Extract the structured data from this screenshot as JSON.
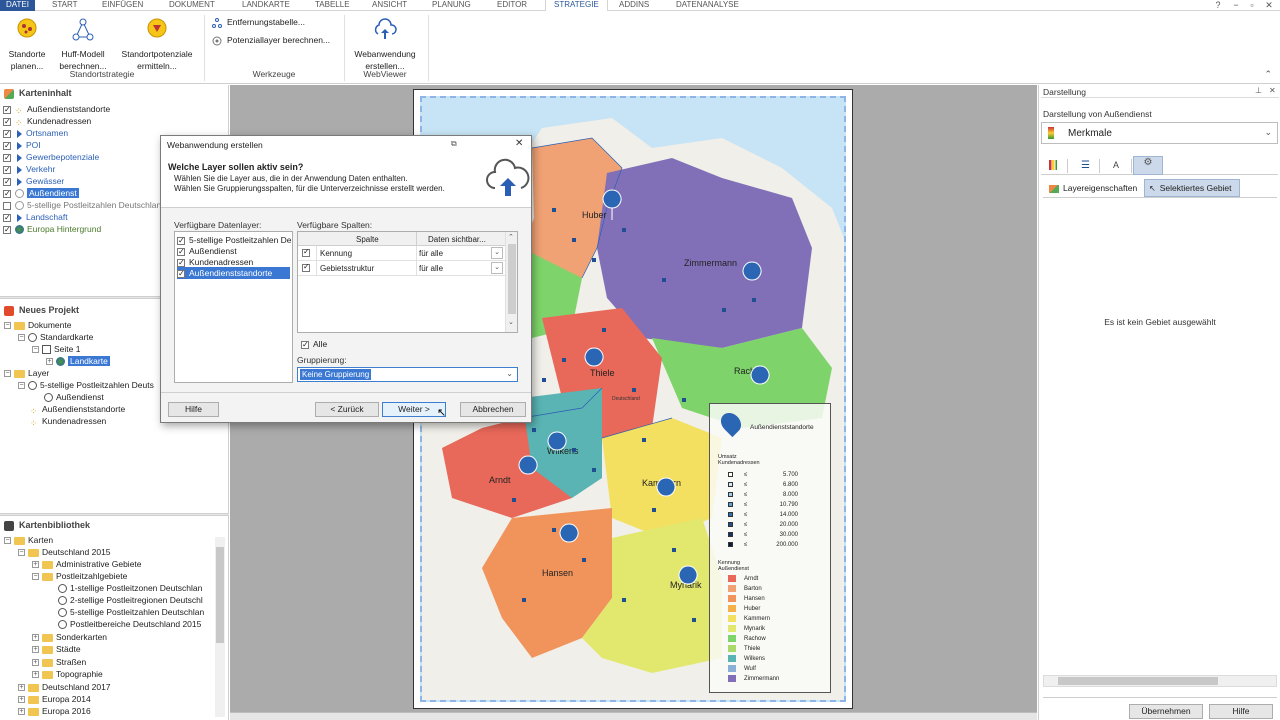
{
  "tabs": [
    "DATEI",
    "START",
    "EINFÜGEN",
    "DOKUMENT",
    "LANDKARTE",
    "TABELLE",
    "ANSICHT",
    "PLANUNG",
    "EDITOR",
    "STRATEGIE",
    "ADDINS",
    "DATENANALYSE"
  ],
  "ribbon": {
    "btn_standorte": [
      "Standorte",
      "planen..."
    ],
    "btn_huff": [
      "Huff-Modell",
      "berechnen..."
    ],
    "btn_potenziale": [
      "Standortpotenziale",
      "ermitteln..."
    ],
    "group_standortstrategie": "Standortstrategie",
    "btn_entfernung": "Entfernungstabelle...",
    "btn_potenziallayer": "Potenziallayer berechnen...",
    "group_werkzeuge": "Werkzeuge",
    "btn_webanwendung": [
      "Webanwendung",
      "erstellen..."
    ],
    "group_webviewer": "WebViewer"
  },
  "kartenInhalt": {
    "title": "Karteninhalt",
    "items": [
      "Außendienststandorte",
      "Kundenadressen",
      "Ortsnamen",
      "POI",
      "Gewerbepotenziale",
      "Verkehr",
      "Gewässer",
      "Außendienst",
      "5-stellige Postleitzahlen Deutschland",
      "Landschaft",
      "Europa Hintergrund"
    ]
  },
  "projekt": {
    "title": "Neues Projekt",
    "items": [
      "Dokumente",
      "Standardkarte",
      "Seite 1",
      "Landkarte",
      "Layer",
      "5-stellige Postleitzahlen Deuts",
      "Außendienst",
      "Außendienststandorte",
      "Kundenadressen"
    ]
  },
  "bibliothek": {
    "title": "Kartenbibliothek",
    "items": [
      "Karten",
      "Deutschland 2015",
      "Administrative Gebiete",
      "Postleitzahlgebiete",
      "1-stellige Postleitzonen Deutschlan",
      "2-stellige Postleitregionen Deutschl",
      "5-stellige Postleitzahlen Deutschlan",
      "Postleitbereiche Deutschland 2015",
      "Sonderkarten",
      "Städte",
      "Straßen",
      "Topographie",
      "Deutschland 2017",
      "Europa 2014",
      "Europa 2016"
    ]
  },
  "map": {
    "region_labels": [
      "Huber",
      "Zimmermann",
      "Thiele",
      "Rachow",
      "Wilkens",
      "Arndt",
      "Kammern",
      "Hansen",
      "Mynarik",
      "Deutschland"
    ],
    "legend_title": "Außendienststandorte",
    "legend_umsatz_title": [
      "Umsatz",
      "Kundenadressen"
    ],
    "legend_umsatz": [
      "5.700",
      "6.800",
      "8.000",
      "10.790",
      "14.000",
      "20.000",
      "30.000",
      "200.000"
    ],
    "legend_le": "≤",
    "legend_kennung_title": [
      "Kennung",
      "Außendienst"
    ],
    "legend_kennung": [
      "Arndt",
      "Barton",
      "Hansen",
      "Huber",
      "Kammern",
      "Mynarik",
      "Rachow",
      "Thiele",
      "Wilkens",
      "Wulf",
      "Zimmermann"
    ],
    "legend_kennung_colors": [
      "#e8685a",
      "#f0a274",
      "#f0945c",
      "#f5b04a",
      "#f3e060",
      "#e2e86e",
      "#7ed46a",
      "#a9d96a",
      "#5ab4b4",
      "#8bb0d8",
      "#8170b8"
    ],
    "umsatz_colors": [
      "#ffffff",
      "#d3e6f8",
      "#9cc8ef",
      "#5aa0d8",
      "#2a70b8",
      "#1f4e91",
      "#14336a",
      "#0a1c3c"
    ]
  },
  "right": {
    "title": "Darstellung",
    "subtitle": "Darstellung von Außendienst",
    "dropdown": "Merkmale",
    "tab1": "Layereigenschaften",
    "tab2": "Selektiertes Gebiet",
    "empty_text": "Es ist kein Gebiet ausgewählt",
    "btn_apply": "Übernehmen",
    "btn_help": "Hilfe"
  },
  "dialog": {
    "title": "Webanwendung erstellen",
    "heading": "Welche Layer sollen aktiv sein?",
    "desc1": "Wählen Sie die Layer aus, die in der Anwendung Daten enthalten.",
    "desc2": "Wählen Sie Gruppierungsspalten, für die Unterverzeichnisse erstellt werden.",
    "layers_label": "Verfügbare Datenlayer:",
    "layers": [
      "5-stellige Postleitzahlen De",
      "Außendienst",
      "Kundenadressen",
      "Außendienststandorte"
    ],
    "cols_label": "Verfügbare Spalten:",
    "col_header1": "Spalte",
    "col_header2": "Daten sichtbar...",
    "rows": [
      {
        "name": "Kennung",
        "vis": "für alle"
      },
      {
        "name": "Gebietsstruktur",
        "vis": "für alle"
      }
    ],
    "alle": "Alle",
    "grouping_label": "Gruppierung:",
    "grouping_value": "Keine Gruppierung",
    "btn_help": "Hilfe",
    "btn_back": "< Zurück",
    "btn_next": "Weiter >",
    "btn_cancel": "Abbrechen"
  }
}
